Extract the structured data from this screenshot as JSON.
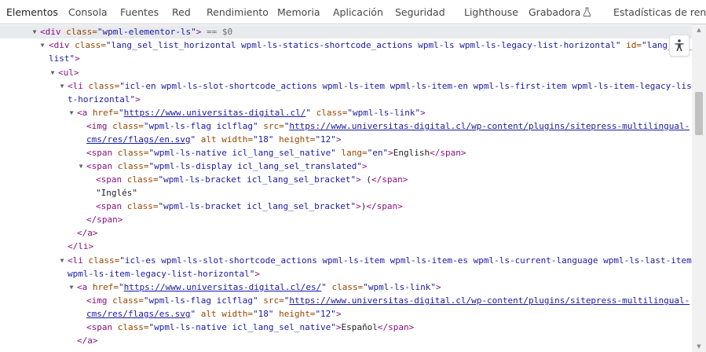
{
  "tabs": [
    {
      "label": "Elementos",
      "active": true
    },
    {
      "label": "Consola"
    },
    {
      "label": "Fuentes"
    },
    {
      "label": "Red"
    },
    {
      "label": "Rendimiento"
    },
    {
      "label": "Memoria"
    },
    {
      "label": "Aplicación"
    },
    {
      "label": "Seguridad"
    },
    {
      "label": "Lighthouse"
    },
    {
      "label": "Grabadora"
    },
    {
      "label": "Estadísticas de rendim"
    }
  ],
  "icons": {
    "recorder": "flask-icon",
    "accessibility": "accessibility-icon",
    "expand": "expand-triangle-icon",
    "collapse": "collapse-triangle-icon"
  },
  "colors": {
    "tag": "#881280",
    "attribute": "#994500",
    "value": "#1a1aa6",
    "selected_row": "#e8eaed",
    "active_tab": "#1a73e8"
  },
  "dom": {
    "l1": {
      "open": "<div ",
      "a1": "class=",
      "v1": "\"wpml-elementor-ls\"",
      "close": ">",
      "eq": " == $0"
    },
    "l2": {
      "open": "<div ",
      "a1": "class=",
      "v1": "\"lang_sel_list_horizontal wpml-ls-statics-shortcode_actions wpml-ls wpml-ls-legacy-list-horizontal\"",
      "a2": " id=",
      "v2": "\"lang_sel_"
    },
    "l2b": {
      "v": "list\"",
      "close": ">"
    },
    "l3": {
      "tag": "<ul>"
    },
    "l4": {
      "open": "<li ",
      "a1": "class=",
      "v1": "\"icl-en wpml-ls-slot-shortcode_actions wpml-ls-item wpml-ls-item-en wpml-ls-first-item wpml-ls-item-legacy-lis"
    },
    "l4b": {
      "v": "t-horizontal\"",
      "close": ">"
    },
    "l5": {
      "open": "<a ",
      "a1": "href=",
      "q1": "\"",
      "link": "https://www.universitas-digital.cl/",
      "q2": "\"",
      "a2": " class=",
      "v2": "\"wpml-ls-link\"",
      "close": ">"
    },
    "l6": {
      "open": "<img ",
      "a1": "class=",
      "v1": "\"wpml-ls-flag iclflag\"",
      "a2": " src=",
      "q1": "\"",
      "link": "https://www.universitas-digital.cl/wp-content/plugins/sitepress-multilingual-"
    },
    "l6b": {
      "link": "cms/res/flags/en.svg",
      "q": "\"",
      "a1": " alt ",
      "a2": "width=",
      "v2": "\"18\"",
      "a3": " height=",
      "v3": "\"12\"",
      "close": ">"
    },
    "l7": {
      "open": "<span ",
      "a1": "class=",
      "v1": "\"wpml-ls-native icl_lang_sel_native\"",
      "a2": " lang=",
      "v2": "\"en\"",
      "close": ">",
      "text": "English",
      "end": "</span>"
    },
    "l8": {
      "open": "<span ",
      "a1": "class=",
      "v1": "\"wpml-ls-display icl_lang_sel_translated\"",
      "close": ">"
    },
    "l9": {
      "open": "<span ",
      "a1": "class=",
      "v1": "\"wpml-ls-bracket icl_lang_sel_bracket\"",
      "close": ">",
      "text": " (",
      "end": "</span>"
    },
    "l10": {
      "text": "\"Inglés\""
    },
    "l11": {
      "open": "<span ",
      "a1": "class=",
      "v1": "\"wpml-ls-bracket icl_lang_sel_bracket\"",
      "close": ">",
      "text": ")",
      "end": "</span>"
    },
    "l12": {
      "tag": "</span>"
    },
    "l13": {
      "tag": "</a>"
    },
    "l14": {
      "tag": "</li>"
    },
    "l15": {
      "open": "<li ",
      "a1": "class=",
      "v1": "\"icl-es wpml-ls-slot-shortcode_actions wpml-ls-item wpml-ls-item-es wpml-ls-current-language wpml-ls-last-item"
    },
    "l15b": {
      "v": "wpml-ls-item-legacy-list-horizontal\"",
      "close": ">"
    },
    "l16": {
      "open": "<a ",
      "a1": "href=",
      "q1": "\"",
      "link": "https://www.universitas-digital.cl/es/",
      "q2": "\"",
      "a2": " class=",
      "v2": "\"wpml-ls-link\"",
      "close": ">"
    },
    "l17": {
      "open": "<img ",
      "a1": "class=",
      "v1": "\"wpml-ls-flag iclflag\"",
      "a2": " src=",
      "q1": "\"",
      "link": "https://www.universitas-digital.cl/wp-content/plugins/sitepress-multilingual-"
    },
    "l17b": {
      "link": "cms/res/flags/es.svg",
      "q": "\"",
      "a1": " alt ",
      "a2": "width=",
      "v2": "\"18\"",
      "a3": " height=",
      "v3": "\"12\"",
      "close": ">"
    },
    "l18": {
      "open": "<span ",
      "a1": "class=",
      "v1": "\"wpml-ls-native icl_lang_sel_native\"",
      "close": ">",
      "text": "Español",
      "end": "</span>"
    },
    "l19": {
      "tag": "</a>"
    }
  }
}
